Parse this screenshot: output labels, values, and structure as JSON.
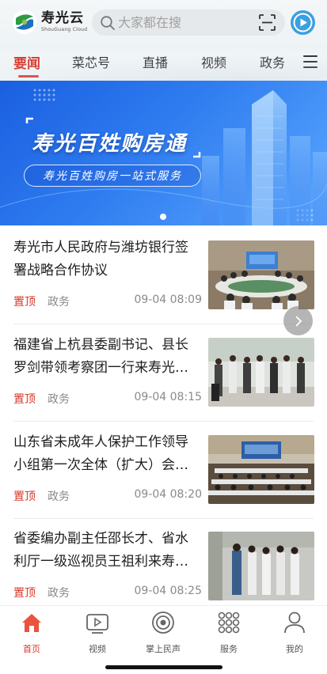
{
  "header": {
    "logo_cn": "寿光云",
    "logo_en": "ShouGuang Cloud",
    "search_placeholder": "大家都在搜"
  },
  "tabs": [
    {
      "label": "要闻",
      "active": true
    },
    {
      "label": "菜芯号",
      "active": false
    },
    {
      "label": "直播",
      "active": false
    },
    {
      "label": "视频",
      "active": false
    },
    {
      "label": "政务",
      "active": false
    }
  ],
  "banner": {
    "title": "寿光百姓购房通",
    "subtitle": "寿光百姓购房一站式服务"
  },
  "news": [
    {
      "title": "寿光市人民政府与潍坊银行签署战略合作协议",
      "pin": "置顶",
      "category": "政务",
      "time": "09-04 08:09"
    },
    {
      "title": "福建省上杭县委副书记、县长罗剑带领考察团一行来寿光考察",
      "pin": "置顶",
      "category": "政务",
      "time": "09-04 08:15"
    },
    {
      "title": "山东省未成年人保护工作领导小组第一次全体（扩大）会议召开",
      "pin": "置顶",
      "category": "政务",
      "time": "09-04 08:20"
    },
    {
      "title": "省委编办副主任邵长才、省水利厅一级巡视员王祖利来寿光调研",
      "pin": "置顶",
      "category": "政务",
      "time": "09-04 08:25"
    }
  ],
  "bottom_nav": [
    {
      "label": "首页",
      "icon": "home-icon",
      "active": true
    },
    {
      "label": "视频",
      "icon": "video-icon",
      "active": false
    },
    {
      "label": "掌上民声",
      "icon": "voice-icon",
      "active": false
    },
    {
      "label": "服务",
      "icon": "grid-icon",
      "active": false
    },
    {
      "label": "我的",
      "icon": "user-icon",
      "active": false
    }
  ],
  "colors": {
    "accent": "#d9372b",
    "banner": "#2f7cf0"
  }
}
